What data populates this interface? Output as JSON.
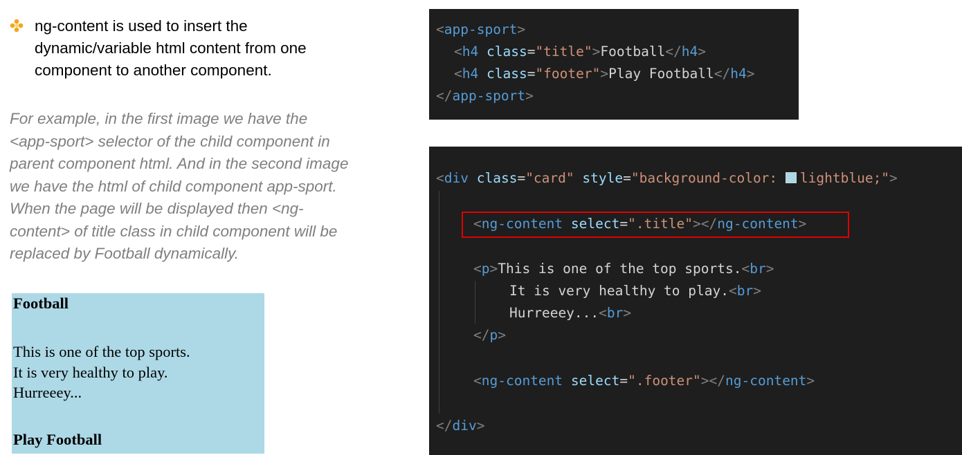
{
  "bullet": {
    "icon": "diamond-bullet-icon",
    "text": "ng-content is used to insert the\ndynamic/variable html content from one\ncomponent to another component."
  },
  "example": {
    "text": "For example, in the first image we have the\n<app-sport> selector of the child component in\nparent component html. And in the second image\nwe have the html of child component app-sport.\nWhen the page will be displayed then <ng-\ncontent> of title class in child component will be\nreplaced by Football dynamically."
  },
  "preview": {
    "background": "#add8e6",
    "title": "Football",
    "body": "This is one of the top sports.\nIt is very healthy to play.\nHurreeey...",
    "footer": "Play Football"
  },
  "code1": {
    "l1_tag": "app-sport",
    "l2_tag": "h4",
    "l2_attr": "class",
    "l2_val": "\"title\"",
    "l2_text": "Football",
    "l3_tag": "h4",
    "l3_attr": "class",
    "l3_val": "\"footer\"",
    "l3_text": "Play Football",
    "l4_tag": "app-sport"
  },
  "code2": {
    "l1_tag": "div",
    "l1_attr1": "class",
    "l1_val1": "\"card\"",
    "l1_attr2": "style",
    "l1_val2a": "\"background-color: ",
    "l1_val2b": "lightblue;\"",
    "l2_tag": "ng-content",
    "l2_attr": "select",
    "l2_val": "\".title\"",
    "l3_tag": "p",
    "l3_text": "This is one of the top sports.",
    "l3_br": "br",
    "l4_text": "It is very healthy to play.",
    "l4_br": "br",
    "l5_text": "Hurreeey...",
    "l5_br": "br",
    "l6_tag": "p",
    "l7_tag": "ng-content",
    "l7_attr": "select",
    "l7_val": "\".footer\"",
    "l8_tag": "div"
  },
  "colors": {
    "code_bg": "#1e1e1e",
    "tag": "#569cd6",
    "attr": "#9cdcfe",
    "string": "#ce9178",
    "highlight": "#e00000",
    "example_text": "#7f7f7f"
  }
}
